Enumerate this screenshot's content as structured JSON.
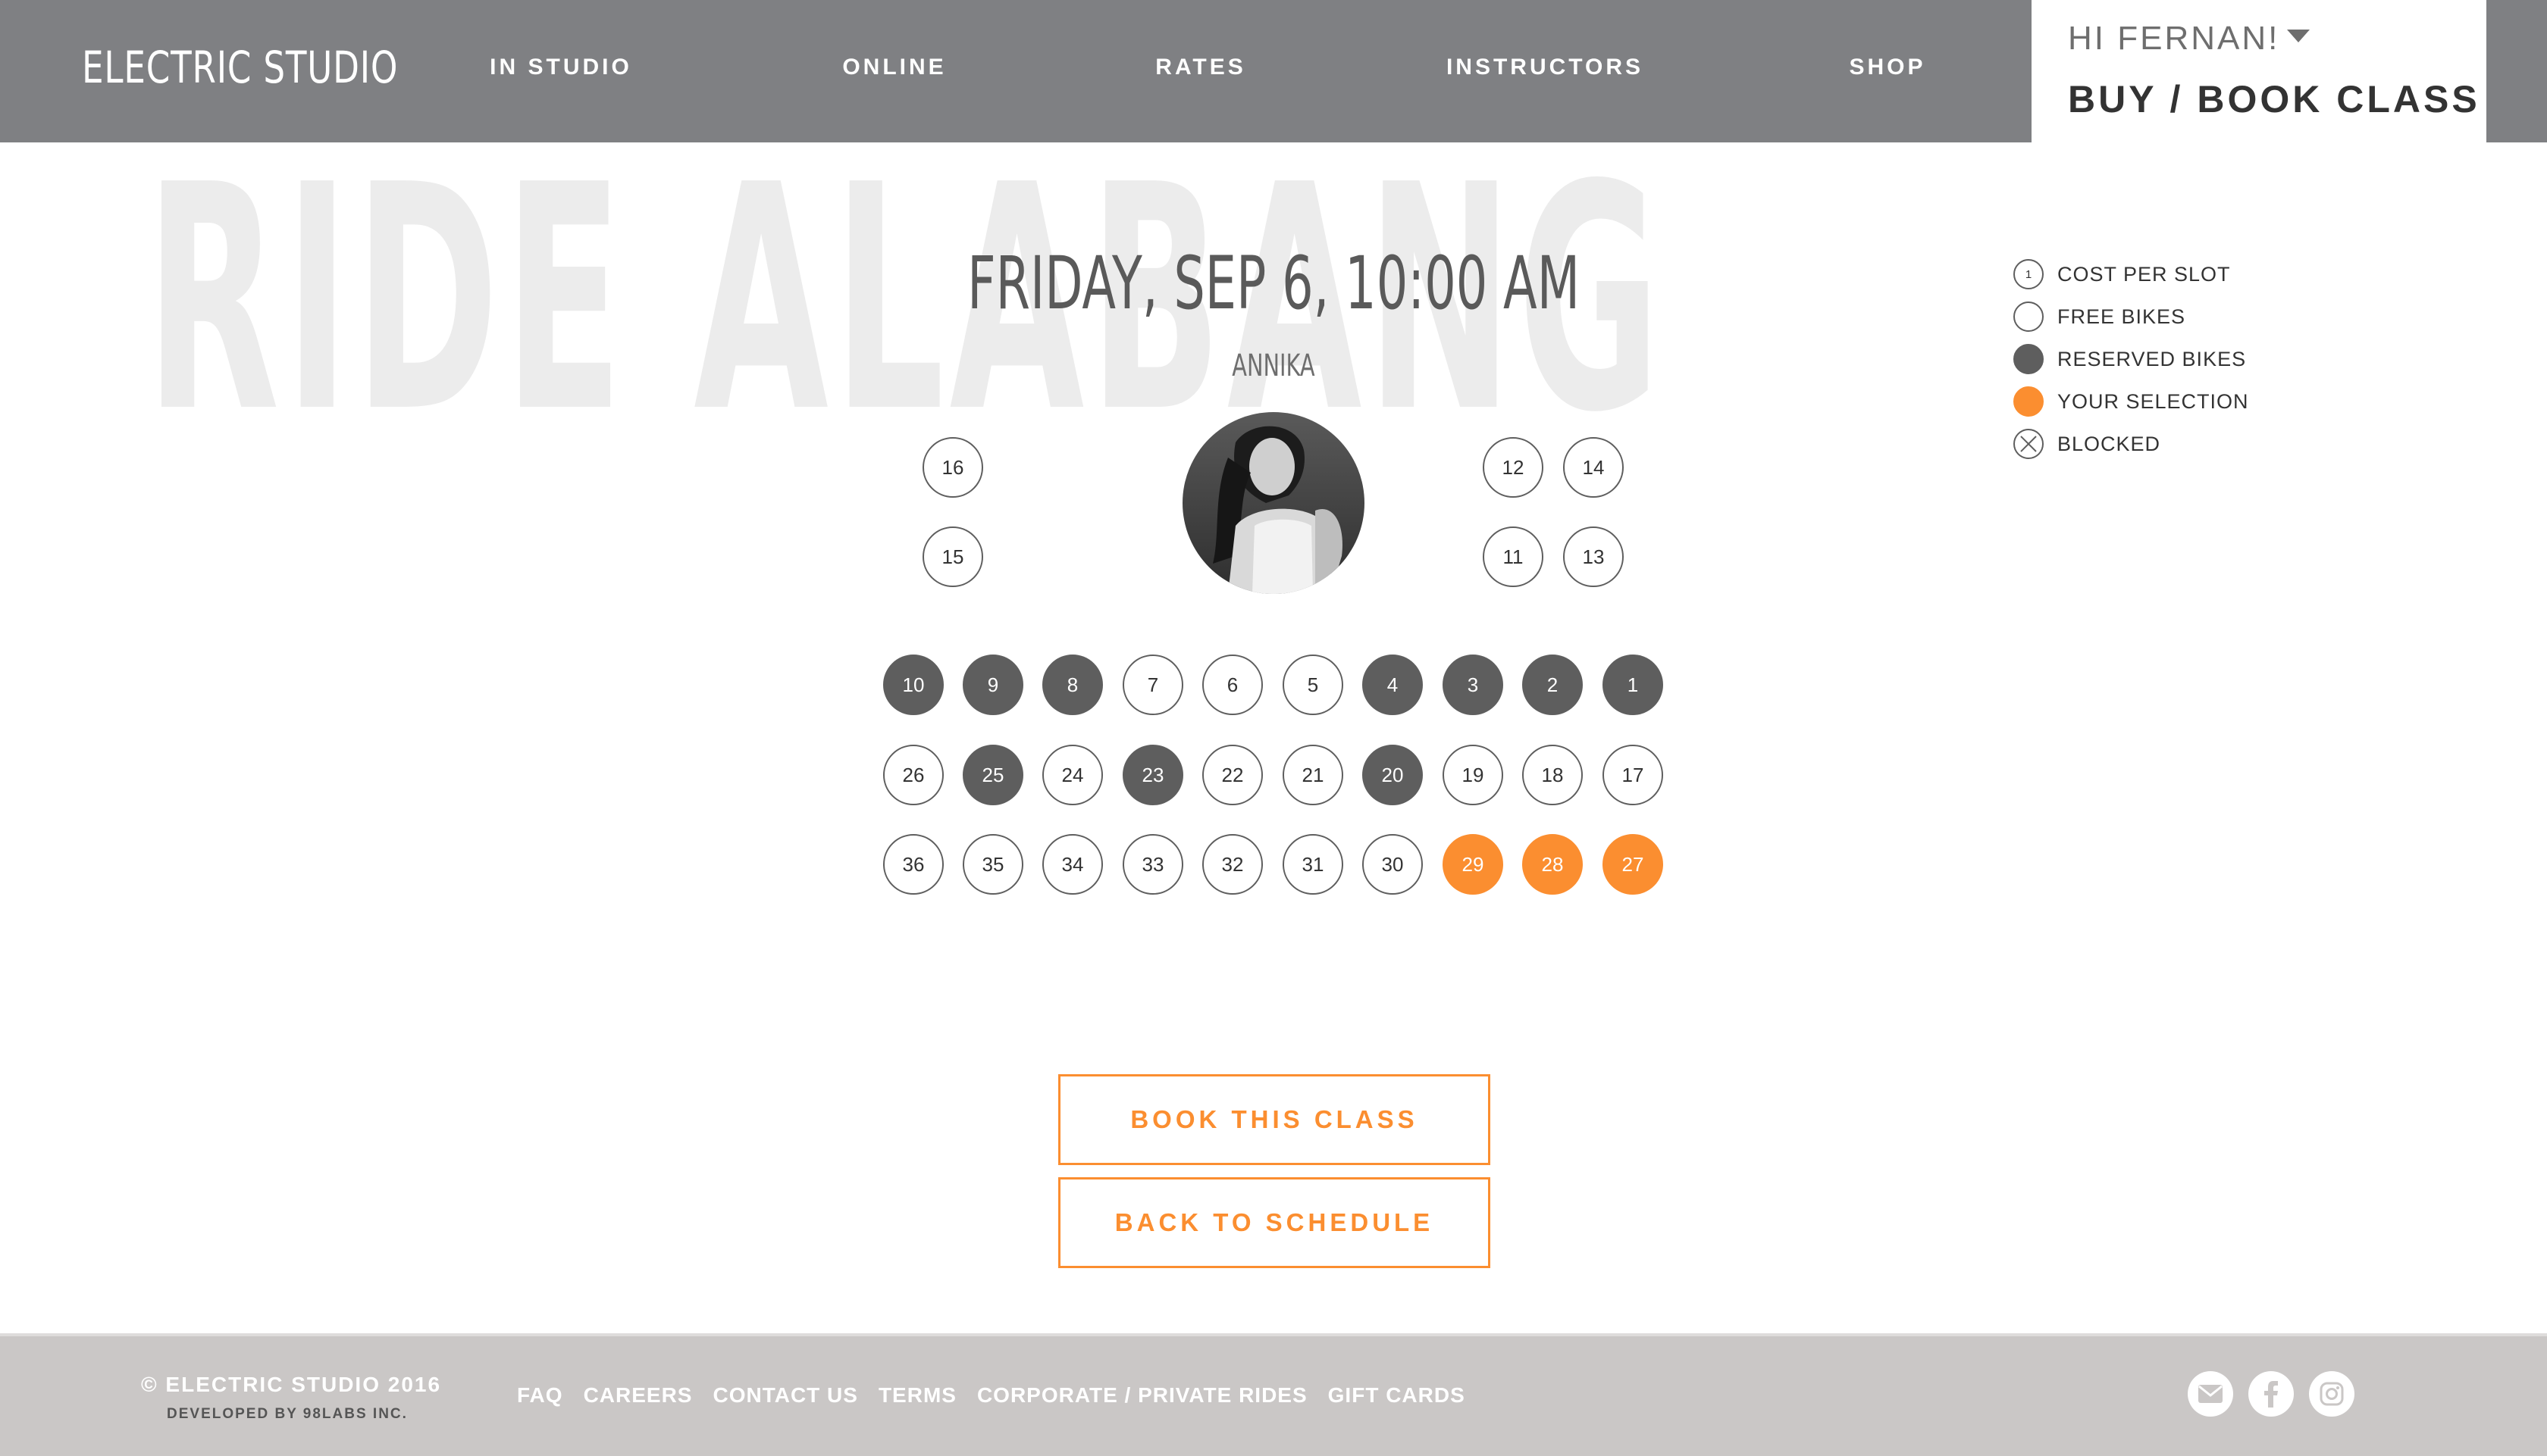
{
  "header": {
    "logo": "ELECTRIC STUDIO",
    "nav": [
      "IN STUDIO",
      "ONLINE",
      "RATES",
      "INSTRUCTORS",
      "SHOP"
    ],
    "greeting": "HI FERNAN!",
    "buy_book": "BUY / BOOK CLASS"
  },
  "hero": {
    "watermark": "RIDE ALABANG",
    "class_title": "FRIDAY, SEP 6, 10:00 AM",
    "instructor": "ANNIKA"
  },
  "bikes": [
    {
      "number": "16",
      "status": "free"
    },
    {
      "number": "15",
      "status": "free"
    },
    {
      "number": "12",
      "status": "free"
    },
    {
      "number": "14",
      "status": "free"
    },
    {
      "number": "11",
      "status": "free"
    },
    {
      "number": "13",
      "status": "free"
    },
    {
      "number": "10",
      "status": "reserved"
    },
    {
      "number": "9",
      "status": "reserved"
    },
    {
      "number": "8",
      "status": "reserved"
    },
    {
      "number": "7",
      "status": "free"
    },
    {
      "number": "6",
      "status": "free"
    },
    {
      "number": "5",
      "status": "free"
    },
    {
      "number": "4",
      "status": "reserved"
    },
    {
      "number": "3",
      "status": "reserved"
    },
    {
      "number": "2",
      "status": "reserved"
    },
    {
      "number": "1",
      "status": "reserved"
    },
    {
      "number": "26",
      "status": "free"
    },
    {
      "number": "25",
      "status": "reserved"
    },
    {
      "number": "24",
      "status": "free"
    },
    {
      "number": "23",
      "status": "reserved"
    },
    {
      "number": "22",
      "status": "free"
    },
    {
      "number": "21",
      "status": "free"
    },
    {
      "number": "20",
      "status": "reserved"
    },
    {
      "number": "19",
      "status": "free"
    },
    {
      "number": "18",
      "status": "free"
    },
    {
      "number": "17",
      "status": "free"
    },
    {
      "number": "36",
      "status": "free"
    },
    {
      "number": "35",
      "status": "free"
    },
    {
      "number": "34",
      "status": "free"
    },
    {
      "number": "33",
      "status": "free"
    },
    {
      "number": "32",
      "status": "free"
    },
    {
      "number": "31",
      "status": "free"
    },
    {
      "number": "30",
      "status": "free"
    },
    {
      "number": "29",
      "status": "selected"
    },
    {
      "number": "28",
      "status": "selected"
    },
    {
      "number": "27",
      "status": "selected"
    }
  ],
  "legend": {
    "cost_icon_value": "1",
    "items": [
      "COST PER SLOT",
      "FREE BIKES",
      "RESERVED BIKES",
      "YOUR SELECTION",
      "BLOCKED"
    ]
  },
  "actions": {
    "book": "BOOK THIS CLASS",
    "back": "BACK TO SCHEDULE"
  },
  "footer": {
    "copyright": "© ELECTRIC STUDIO 2016",
    "developed": "DEVELOPED BY 98LABS INC.",
    "links": [
      "FAQ",
      "CAREERS",
      "CONTACT US",
      "TERMS",
      "CORPORATE / PRIVATE RIDES",
      "GIFT CARDS"
    ],
    "social_icons": [
      "email-icon",
      "facebook-icon",
      "instagram-icon"
    ]
  },
  "colors": {
    "header_bg": "#7f8083",
    "accent": "#fb8e30",
    "reserved": "#5e5e5e",
    "footer_bg": "#cac7c6"
  }
}
